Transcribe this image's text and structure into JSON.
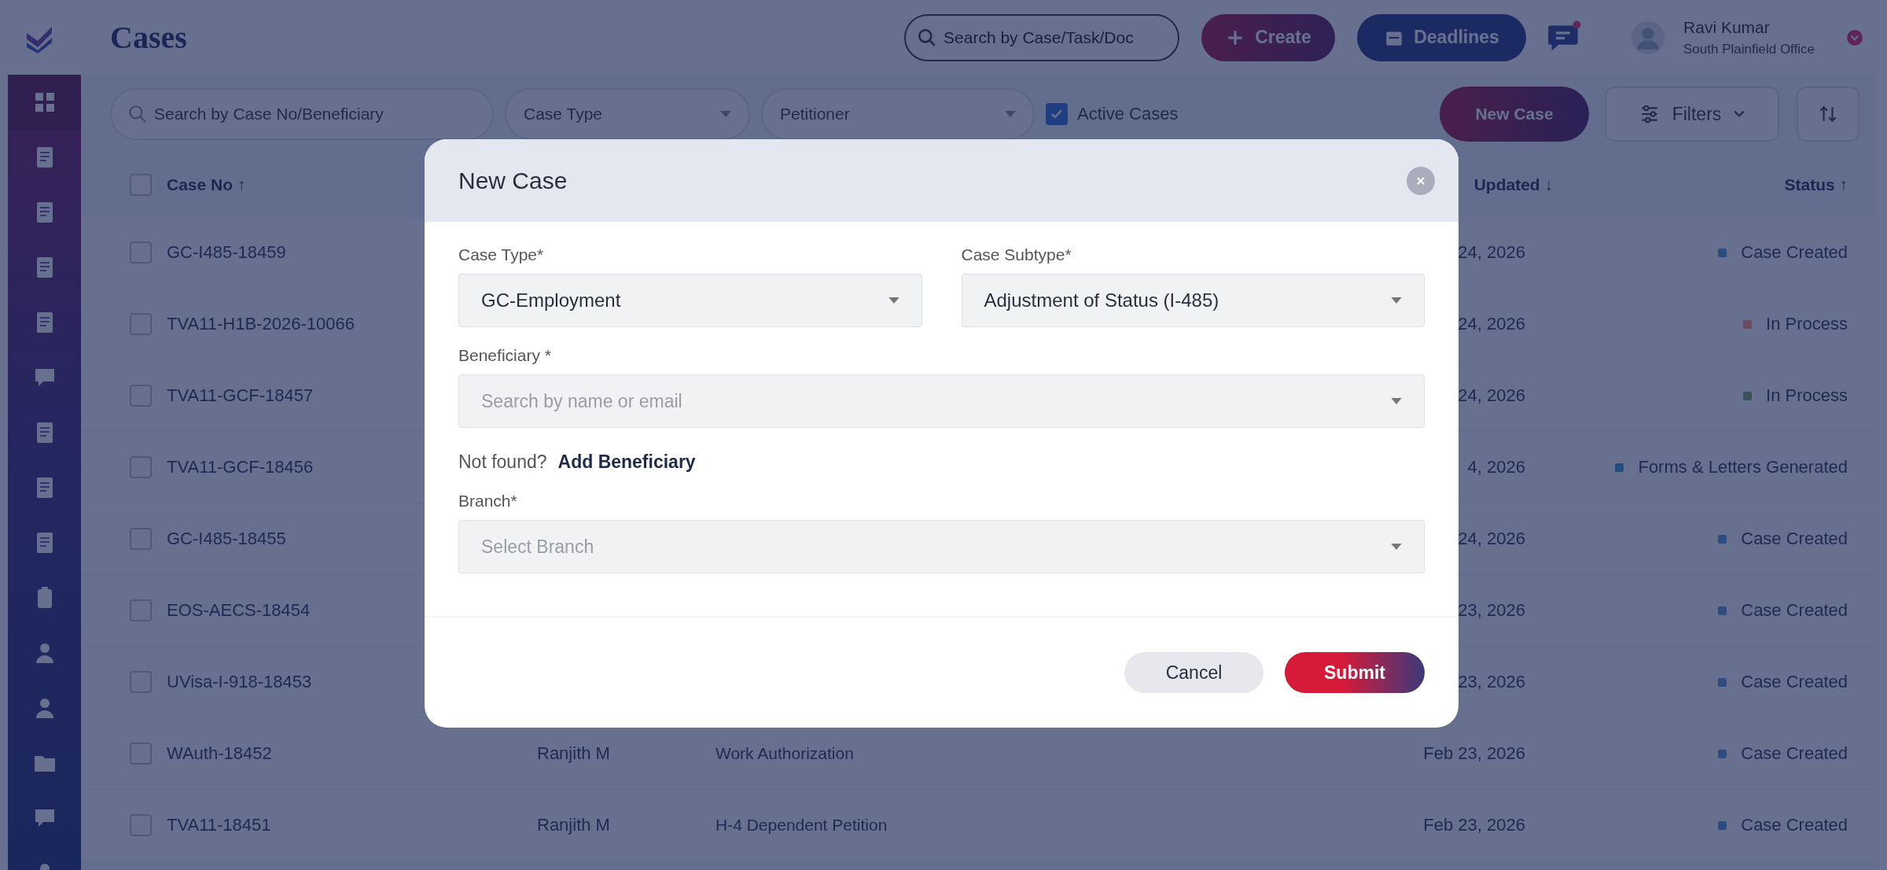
{
  "topbar": {
    "title": "Cases",
    "search": {
      "placeholder": "Search by Case/Task/Doc"
    },
    "create_button": "Create",
    "deadlines_button": "Deadlines",
    "user": {
      "name": "Ravi Kumar",
      "office": "South Plainfield Office"
    }
  },
  "toolbar": {
    "search": {
      "placeholder": "Search by Case No/Beneficiary"
    },
    "case_type": {
      "placeholder": "Case Type"
    },
    "petitioner": {
      "placeholder": "Petitioner"
    },
    "active_cases": {
      "label": "Active Cases",
      "checked": true
    },
    "new_case_button": "New Case",
    "filters_button": "Filters"
  },
  "table": {
    "header_checked": false,
    "columns": [
      {
        "label": "Case No ↑"
      },
      {
        "label": "Updated ↓"
      },
      {
        "label": "Status ↑"
      }
    ],
    "rows": [
      {
        "case_no": "GC-I485-18459",
        "updated": "24, 2026",
        "status": "Case Created",
        "color": "#2e4c7e",
        "checked": false
      },
      {
        "case_no": "TVA11-H1B-2026-10066",
        "updated": "24, 2026",
        "status": "In Process",
        "color": "#6e4a5e",
        "checked": false
      },
      {
        "case_no": "TVA11-GCF-18457",
        "updated": "24, 2026",
        "status": "In Process",
        "color": "#3a5256",
        "checked": false
      },
      {
        "case_no": "TVA11-GCF-18456",
        "updated": "4, 2026",
        "status": "Forms & Letters Generated",
        "color": "#1f4c7c",
        "checked": false
      },
      {
        "case_no": "GC-I485-18455",
        "updated": "24, 2026",
        "status": "Case Created",
        "color": "#2e4c7e",
        "checked": false
      },
      {
        "case_no": "EOS-AECS-18454",
        "updated": "23, 2026",
        "status": "Case Created",
        "color": "#2e4c7e",
        "checked": false
      },
      {
        "case_no": "UVisa-I-918-18453",
        "updated": "23, 2026",
        "status": "Case Created",
        "color": "#2e4c7e",
        "checked": false
      },
      {
        "case_no": "WAuth-18452",
        "beneficiary": "Ranjith M",
        "case_type": "Work Authorization",
        "updated": "Feb 23, 2026",
        "status": "Case Created",
        "color": "#2e4c7e",
        "checked": false
      },
      {
        "case_no": "TVA11-18451",
        "beneficiary": "Ranjith M",
        "case_type": "H-4 Dependent Petition",
        "updated": "Feb 23, 2026",
        "status": "Case Created",
        "color": "#2e4c7e",
        "checked": false
      }
    ]
  },
  "modal": {
    "title": "New Case",
    "fields": [
      {
        "label": "Case Type*",
        "value": "GC-Employment"
      },
      {
        "label": "Case Subtype*",
        "value": "Adjustment of Status (I-485)"
      },
      {
        "label": "Beneficiary *",
        "placeholder": "Search by name or email"
      },
      {
        "label": "Branch*",
        "placeholder": "Select Branch"
      }
    ],
    "not_found": {
      "text": "Not found?",
      "link": "Add Beneficiary"
    },
    "cancel_button": "Cancel",
    "submit_button": "Submit"
  }
}
